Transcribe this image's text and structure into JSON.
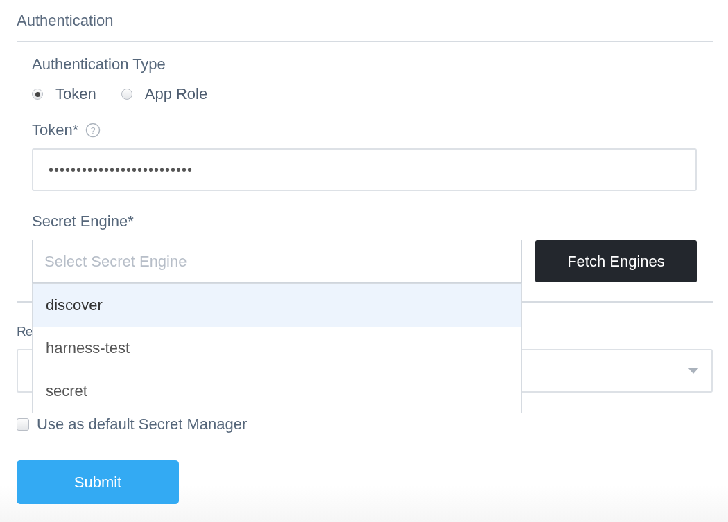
{
  "section_title": "Authentication",
  "auth_type": {
    "label": "Authentication Type",
    "options": [
      {
        "label": "Token",
        "selected": true
      },
      {
        "label": "App Role",
        "selected": false
      }
    ]
  },
  "token": {
    "label": "Token*",
    "help": "?",
    "value": "••••••••••••••••••••••••••"
  },
  "secret_engine": {
    "label": "Secret Engine*",
    "placeholder": "Select Secret Engine",
    "button": "Fetch Engines",
    "expanded": true,
    "options": [
      {
        "label": "discover",
        "selected": true
      },
      {
        "label": "harness-test",
        "selected": false
      },
      {
        "label": "secret",
        "selected": false
      }
    ]
  },
  "covered_field": {
    "label": "Re"
  },
  "default_manager": {
    "label": "Use as default Secret Manager",
    "checked": false
  },
  "submit": "Submit"
}
